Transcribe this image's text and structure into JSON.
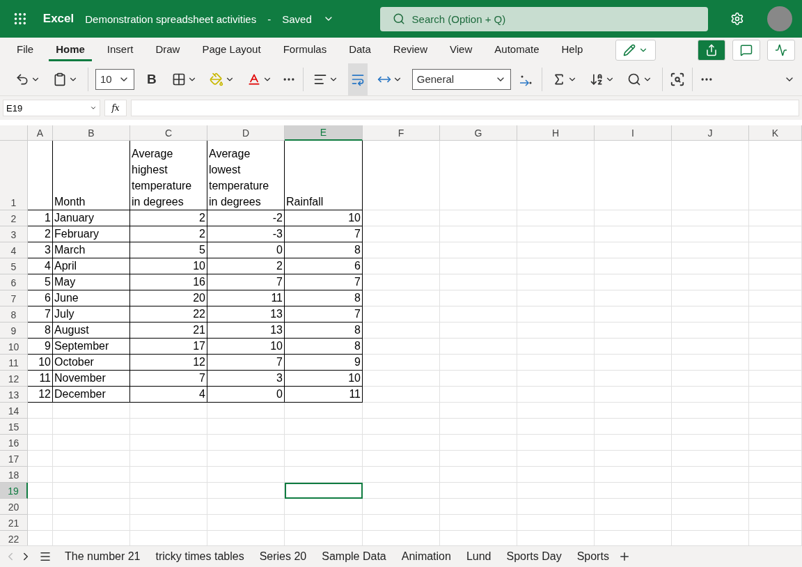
{
  "app_bar": {
    "app_name": "Excel",
    "document_title": "Demonstration spreadsheet activities",
    "separator": "-",
    "save_status": "Saved",
    "search_placeholder": "Search (Option + Q)"
  },
  "ribbon_tabs": [
    {
      "label": "File",
      "selected": false
    },
    {
      "label": "Home",
      "selected": true
    },
    {
      "label": "Insert",
      "selected": false
    },
    {
      "label": "Draw",
      "selected": false
    },
    {
      "label": "Page Layout",
      "selected": false
    },
    {
      "label": "Formulas",
      "selected": false
    },
    {
      "label": "Data",
      "selected": false
    },
    {
      "label": "Review",
      "selected": false
    },
    {
      "label": "View",
      "selected": false
    },
    {
      "label": "Automate",
      "selected": false
    },
    {
      "label": "Help",
      "selected": false
    }
  ],
  "toolbar": {
    "font_size": "10",
    "bold_label": "B",
    "wrap_text_on": true,
    "number_format": "General"
  },
  "formula_bar": {
    "name_box": "E19",
    "function_label": "fx"
  },
  "columns": [
    {
      "label": "A",
      "selected": false
    },
    {
      "label": "B",
      "selected": false
    },
    {
      "label": "C",
      "selected": false
    },
    {
      "label": "D",
      "selected": false
    },
    {
      "label": "E",
      "selected": true
    },
    {
      "label": "F",
      "selected": false
    },
    {
      "label": "G",
      "selected": false
    },
    {
      "label": "H",
      "selected": false
    },
    {
      "label": "I",
      "selected": false
    },
    {
      "label": "J",
      "selected": false
    },
    {
      "label": "K",
      "selected": false
    }
  ],
  "rows": [
    {
      "number": "1",
      "kind": "header",
      "selected": false,
      "bordered": true,
      "cells": {
        "B": "Month",
        "C": "Average highest temperature in degrees",
        "D": "Average lowest temperature in degrees",
        "E": "Rainfall"
      }
    },
    {
      "number": "2",
      "kind": "data",
      "selected": false,
      "bordered": true,
      "cells": {
        "A": "1",
        "B": "January",
        "C": "2",
        "D": "-2",
        "E": "10"
      }
    },
    {
      "number": "3",
      "kind": "data",
      "selected": false,
      "bordered": true,
      "cells": {
        "A": "2",
        "B": "February",
        "C": "2",
        "D": "-3",
        "E": "7"
      }
    },
    {
      "number": "4",
      "kind": "data",
      "selected": false,
      "bordered": true,
      "cells": {
        "A": "3",
        "B": "March",
        "C": "5",
        "D": "0",
        "E": "8"
      }
    },
    {
      "number": "5",
      "kind": "data",
      "selected": false,
      "bordered": true,
      "cells": {
        "A": "4",
        "B": "April",
        "C": "10",
        "D": "2",
        "E": "6"
      }
    },
    {
      "number": "6",
      "kind": "data",
      "selected": false,
      "bordered": true,
      "cells": {
        "A": "5",
        "B": "May",
        "C": "16",
        "D": "7",
        "E": "7"
      }
    },
    {
      "number": "7",
      "kind": "data",
      "selected": false,
      "bordered": true,
      "cells": {
        "A": "6",
        "B": "June",
        "C": "20",
        "D": "11",
        "E": "8"
      }
    },
    {
      "number": "8",
      "kind": "data",
      "selected": false,
      "bordered": true,
      "cells": {
        "A": "7",
        "B": "July",
        "C": "22",
        "D": "13",
        "E": "7"
      }
    },
    {
      "number": "9",
      "kind": "data",
      "selected": false,
      "bordered": true,
      "cells": {
        "A": "8",
        "B": "August",
        "C": "21",
        "D": "13",
        "E": "8"
      }
    },
    {
      "number": "10",
      "kind": "data",
      "selected": false,
      "bordered": true,
      "cells": {
        "A": "9",
        "B": "September",
        "C": "17",
        "D": "10",
        "E": "8"
      }
    },
    {
      "number": "11",
      "kind": "data",
      "selected": false,
      "bordered": true,
      "cells": {
        "A": "10",
        "B": "October",
        "C": "12",
        "D": "7",
        "E": "9"
      }
    },
    {
      "number": "12",
      "kind": "data",
      "selected": false,
      "bordered": true,
      "cells": {
        "A": "11",
        "B": "November",
        "C": "7",
        "D": "3",
        "E": "10"
      }
    },
    {
      "number": "13",
      "kind": "data",
      "selected": false,
      "bordered": true,
      "cells": {
        "A": "12",
        "B": "December",
        "C": "4",
        "D": "0",
        "E": "11"
      }
    },
    {
      "number": "14",
      "kind": "data",
      "selected": false,
      "bordered": false
    },
    {
      "number": "15",
      "kind": "data",
      "selected": false,
      "bordered": false
    },
    {
      "number": "16",
      "kind": "data",
      "selected": false,
      "bordered": false
    },
    {
      "number": "17",
      "kind": "data",
      "selected": false,
      "bordered": false
    },
    {
      "number": "18",
      "kind": "data",
      "selected": false,
      "bordered": false
    },
    {
      "number": "19",
      "kind": "data",
      "selected": true,
      "bordered": false
    },
    {
      "number": "20",
      "kind": "data",
      "selected": false,
      "bordered": false
    },
    {
      "number": "21",
      "kind": "data",
      "selected": false,
      "bordered": false
    },
    {
      "number": "22",
      "kind": "data",
      "selected": false,
      "bordered": false
    }
  ],
  "sheet_tabs": [
    {
      "label": "The number 21",
      "selected": false
    },
    {
      "label": "tricky times tables",
      "selected": false
    },
    {
      "label": "Series 20",
      "selected": false
    },
    {
      "label": "Sample Data",
      "selected": false
    },
    {
      "label": "Animation",
      "selected": false
    },
    {
      "label": "Lund",
      "selected": false
    },
    {
      "label": "Sports Day",
      "selected": false
    },
    {
      "label": "Sports",
      "selected": false
    }
  ]
}
